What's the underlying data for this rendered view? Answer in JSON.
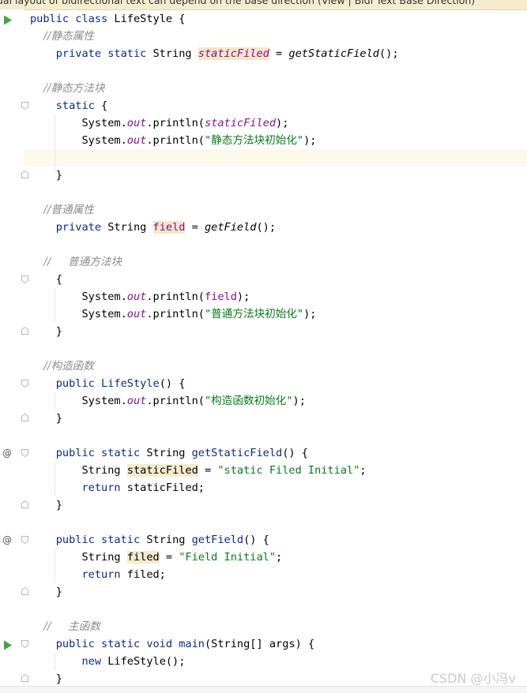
{
  "banner": {
    "text": "ual layout of bidirectional text can depend on the base direction (View | Bidi Text Base Direction)"
  },
  "gutter": {
    "run_icon": "play-triangle-icon",
    "override_icon": "at-sign-override-icon",
    "override_glyph": "@",
    "fold_icon": "fold-marker-icon"
  },
  "code": {
    "l1": [
      {
        "t": "public class ",
        "c": "kw"
      },
      {
        "t": "LifeStyle {",
        "c": "plain"
      }
    ],
    "l2": [
      {
        "t": "    //静态属性",
        "c": "cm"
      }
    ],
    "l3": [
      {
        "t": "    private static ",
        "c": "kw"
      },
      {
        "t": "String ",
        "c": "plain"
      },
      {
        "t": "staticFiled",
        "c": "field",
        "hl": "write"
      },
      {
        "t": " = ",
        "c": "plain"
      },
      {
        "t": "getStaticField",
        "c": "call"
      },
      {
        "t": "();",
        "c": "plain"
      }
    ],
    "l5": [
      {
        "t": "    //静态方法块",
        "c": "cm"
      }
    ],
    "l6": [
      {
        "t": "    static ",
        "c": "kw"
      },
      {
        "t": "{",
        "c": "plain"
      }
    ],
    "l7": [
      {
        "t": "        System.",
        "c": "plain"
      },
      {
        "t": "out",
        "c": "field"
      },
      {
        "t": ".println(",
        "c": "plain"
      },
      {
        "t": "staticFiled",
        "c": "field"
      },
      {
        "t": ");",
        "c": "plain"
      }
    ],
    "l8": [
      {
        "t": "        System.",
        "c": "plain"
      },
      {
        "t": "out",
        "c": "field"
      },
      {
        "t": ".println(",
        "c": "plain"
      },
      {
        "t": "\"静态方法块初始化\"",
        "c": "str"
      },
      {
        "t": ");",
        "c": "plain"
      }
    ],
    "l10": [
      {
        "t": "    }",
        "c": "plain"
      }
    ],
    "l12": [
      {
        "t": "    //普通属性",
        "c": "cm"
      }
    ],
    "l13": [
      {
        "t": "    private ",
        "c": "kw"
      },
      {
        "t": "String ",
        "c": "plain"
      },
      {
        "t": "field",
        "c": "ivar",
        "hl": "write"
      },
      {
        "t": " = ",
        "c": "plain"
      },
      {
        "t": "getField",
        "c": "call"
      },
      {
        "t": "();",
        "c": "plain"
      }
    ],
    "l15": [
      {
        "t": "    //     普通方法块",
        "c": "cm"
      }
    ],
    "l16": [
      {
        "t": "    {",
        "c": "plain"
      }
    ],
    "l17": [
      {
        "t": "        System.",
        "c": "plain"
      },
      {
        "t": "out",
        "c": "field"
      },
      {
        "t": ".println(",
        "c": "plain"
      },
      {
        "t": "field",
        "c": "ivar"
      },
      {
        "t": ");",
        "c": "plain"
      }
    ],
    "l18": [
      {
        "t": "        System.",
        "c": "plain"
      },
      {
        "t": "out",
        "c": "field"
      },
      {
        "t": ".println(",
        "c": "plain"
      },
      {
        "t": "\"普通方法块初始化\"",
        "c": "str"
      },
      {
        "t": ");",
        "c": "plain"
      }
    ],
    "l19": [
      {
        "t": "    }",
        "c": "plain"
      }
    ],
    "l21": [
      {
        "t": "    //构造函数",
        "c": "cm"
      }
    ],
    "l22": [
      {
        "t": "    public ",
        "c": "kw"
      },
      {
        "t": "LifeStyle",
        "c": "kw"
      },
      {
        "t": "() {",
        "c": "plain"
      }
    ],
    "l23": [
      {
        "t": "        System.",
        "c": "plain"
      },
      {
        "t": "out",
        "c": "field"
      },
      {
        "t": ".println(",
        "c": "plain"
      },
      {
        "t": "\"构造函数初始化\"",
        "c": "str"
      },
      {
        "t": ");",
        "c": "plain"
      }
    ],
    "l24": [
      {
        "t": "    }",
        "c": "plain"
      }
    ],
    "l26": [
      {
        "t": "    public static ",
        "c": "kw"
      },
      {
        "t": "String ",
        "c": "plain"
      },
      {
        "t": "getStaticField",
        "c": "kw"
      },
      {
        "t": "() {",
        "c": "plain"
      }
    ],
    "l27": [
      {
        "t": "        String ",
        "c": "plain"
      },
      {
        "t": "staticFiled",
        "c": "plain",
        "hl": "read"
      },
      {
        "t": " = ",
        "c": "plain"
      },
      {
        "t": "\"static Filed Initial\"",
        "c": "str"
      },
      {
        "t": ";",
        "c": "plain"
      }
    ],
    "l28": [
      {
        "t": "        return ",
        "c": "kw"
      },
      {
        "t": "staticFiled;",
        "c": "plain"
      }
    ],
    "l29": [
      {
        "t": "    }",
        "c": "plain"
      }
    ],
    "l31": [
      {
        "t": "    public static ",
        "c": "kw"
      },
      {
        "t": "String ",
        "c": "plain"
      },
      {
        "t": "getField",
        "c": "kw"
      },
      {
        "t": "() {",
        "c": "plain"
      }
    ],
    "l32": [
      {
        "t": "        String ",
        "c": "plain"
      },
      {
        "t": "filed",
        "c": "plain",
        "hl": "read"
      },
      {
        "t": " = ",
        "c": "plain"
      },
      {
        "t": "\"Field Initial\"",
        "c": "str"
      },
      {
        "t": ";",
        "c": "plain"
      }
    ],
    "l33": [
      {
        "t": "        return ",
        "c": "kw"
      },
      {
        "t": "filed;",
        "c": "plain"
      }
    ],
    "l34": [
      {
        "t": "    }",
        "c": "plain"
      }
    ],
    "l36": [
      {
        "t": "    //     主函数",
        "c": "cm"
      }
    ],
    "l37": [
      {
        "t": "    public static void ",
        "c": "kw"
      },
      {
        "t": "main",
        "c": "kw"
      },
      {
        "t": "(String[] args) {",
        "c": "plain"
      }
    ],
    "l38": [
      {
        "t": "        new ",
        "c": "kw"
      },
      {
        "t": "LifeStyle();",
        "c": "plain"
      }
    ],
    "l39": [
      {
        "t": "    }",
        "c": "plain"
      }
    ]
  },
  "watermark": "CSDN @小冯v"
}
